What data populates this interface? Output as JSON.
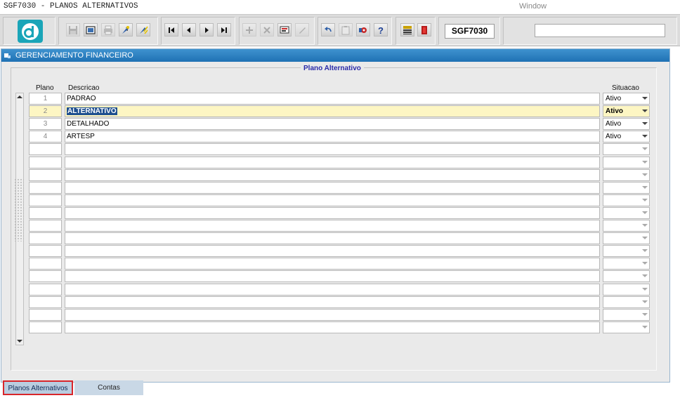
{
  "titlebar": {
    "title": "SGF7030 - PLANOS ALTERNATIVOS",
    "window_menu": "Window"
  },
  "toolbar": {
    "form_code": "SGF7030",
    "search_value": "",
    "buttons": [
      "save-icon",
      "enter-query-icon",
      "print-icon",
      "execute-query-icon",
      "cancel-query-icon",
      "first-record-icon",
      "previous-record-icon",
      "next-record-icon",
      "last-record-icon",
      "insert-record-icon",
      "delete-record-icon",
      "clear-form-icon",
      "edit-icon",
      "undo-icon",
      "clipboard-icon",
      "settings-icon",
      "help-icon",
      "menu-icon",
      "exit-icon"
    ]
  },
  "window": {
    "title": "GERENCIAMENTO FINANCEIRO"
  },
  "frame": {
    "title": "Plano Alternativo"
  },
  "columns": {
    "plano": "Plano",
    "descricao": "Descricao",
    "situacao": "Situacao"
  },
  "rows": [
    {
      "plano": "1",
      "descricao": "PADRAO",
      "situacao": "Ativo"
    },
    {
      "plano": "2",
      "descricao": "ALTERNATIVO",
      "situacao": "Ativo"
    },
    {
      "plano": "3",
      "descricao": "DETALHADO",
      "situacao": "Ativo"
    },
    {
      "plano": "4",
      "descricao": "ARTESP",
      "situacao": "Ativo"
    }
  ],
  "current_row": 1,
  "empty_rows": 15,
  "tabs": [
    {
      "label": "Planos Alternativos",
      "active": true
    },
    {
      "label": "Contas",
      "active": false
    }
  ],
  "colors": {
    "window_title": "#2a7fc2",
    "current_row": "#fdf6c3",
    "selection": "#1e4f8f",
    "frame_title": "#2a2aa8",
    "active_tab_border": "#d8262b"
  }
}
